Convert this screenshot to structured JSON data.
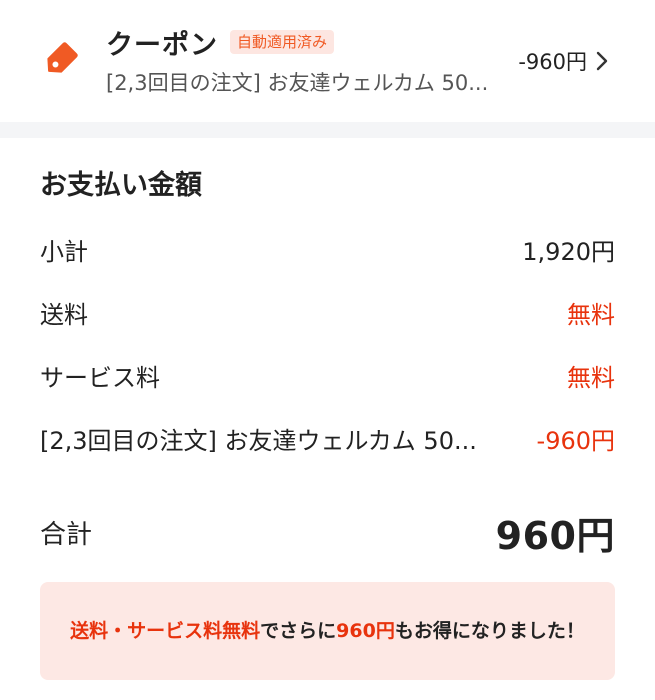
{
  "coupon": {
    "title": "クーポン",
    "badge": "自動適用済み",
    "description": "[2,3回目の注文] お友達ウェルカム 50...",
    "amount": "-960円",
    "icon": "tag-icon",
    "accent_color": "#f05a24"
  },
  "payment": {
    "heading": "お支払い金額",
    "lines": [
      {
        "label": "小計",
        "value": "1,920円"
      },
      {
        "label": "送料",
        "value": "無料"
      },
      {
        "label": "サービス料",
        "value": "無料"
      },
      {
        "label": "[2,3回目の注文] お友達ウェルカム 50...",
        "value": "-960円"
      }
    ],
    "total_label": "合計",
    "total_value": "960円"
  },
  "savings": {
    "part1": "送料・サービス料無料",
    "part2": "でさらに",
    "part3": "960円",
    "part4": "もお得になりました！"
  },
  "colors": {
    "highlight_red": "#e8330d",
    "divider_gray": "#f4f5f7",
    "savings_bg": "#fde8e4"
  }
}
